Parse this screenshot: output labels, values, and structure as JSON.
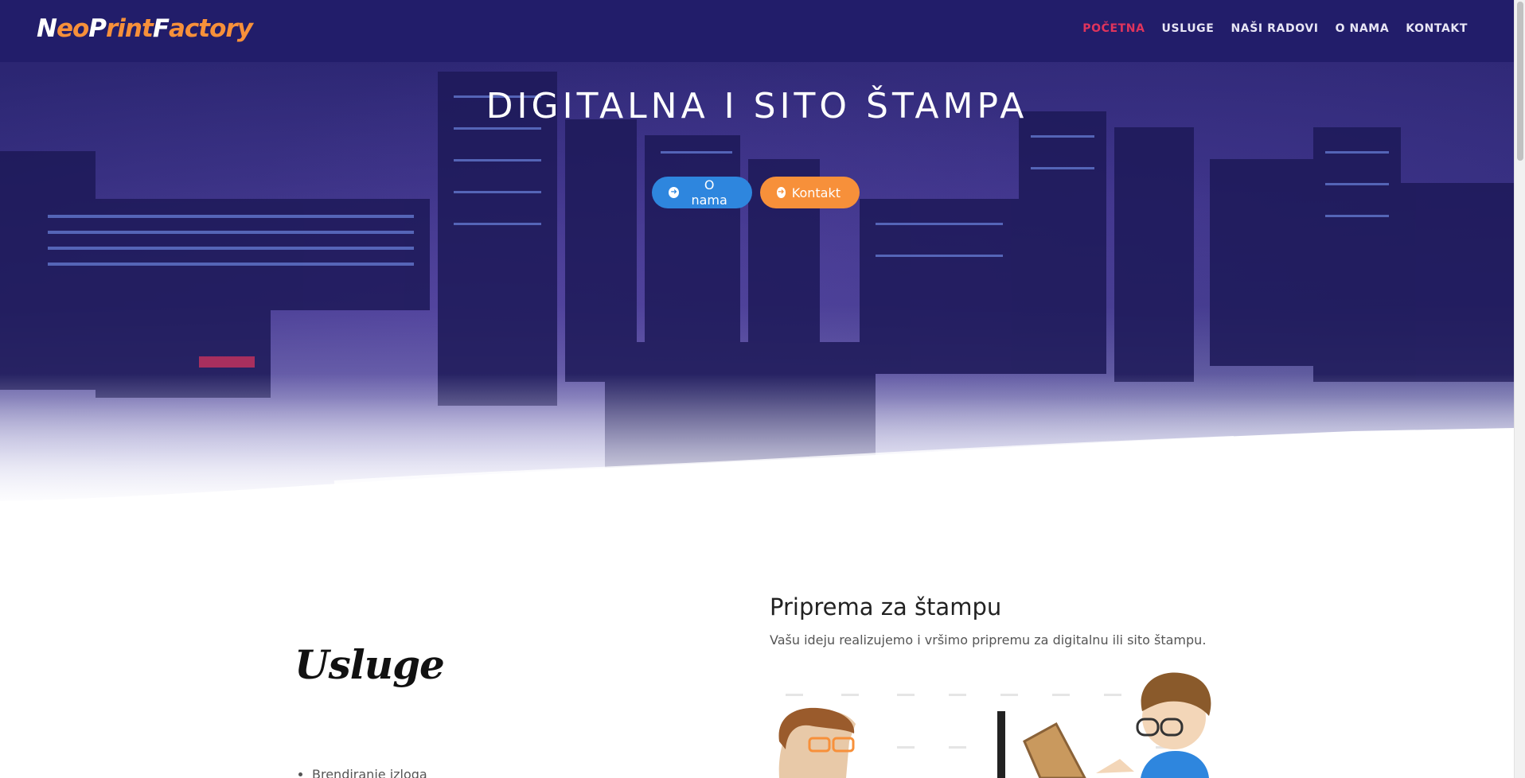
{
  "header": {
    "logo_parts": [
      {
        "text": "N",
        "tone": "white"
      },
      {
        "text": "eo",
        "tone": "orange"
      },
      {
        "text": "P",
        "tone": "white"
      },
      {
        "text": "rint",
        "tone": "orange"
      },
      {
        "text": "F",
        "tone": "white"
      },
      {
        "text": "actory",
        "tone": "orange"
      }
    ],
    "nav": [
      {
        "label": "POČETNA",
        "active": true
      },
      {
        "label": "USLUGE",
        "active": false
      },
      {
        "label": "NAŠI RADOVI",
        "active": false
      },
      {
        "label": "O NAMA",
        "active": false
      },
      {
        "label": "KONTAKT",
        "active": false
      }
    ]
  },
  "hero": {
    "title": "DIGITALNA I SITO ŠTAMPA",
    "buttons": [
      {
        "label": "O nama",
        "icon": "arrow-circle-right-icon"
      },
      {
        "label": "Kontakt",
        "icon": "arrow-circle-right-icon"
      }
    ]
  },
  "services": {
    "heading": "Usluge",
    "items": [
      "Brendiranje izloga"
    ]
  },
  "prep": {
    "title": "Priprema za štampu",
    "description": "Vašu ideju realizujemo i vršimo pripremu za digitalnu ili sito štampu."
  },
  "colors": {
    "navbar": "#221d6a",
    "active_nav": "#e0345c",
    "blue_button": "#2e86de",
    "orange_button": "#f7903a",
    "logo_orange": "#f7903a"
  }
}
